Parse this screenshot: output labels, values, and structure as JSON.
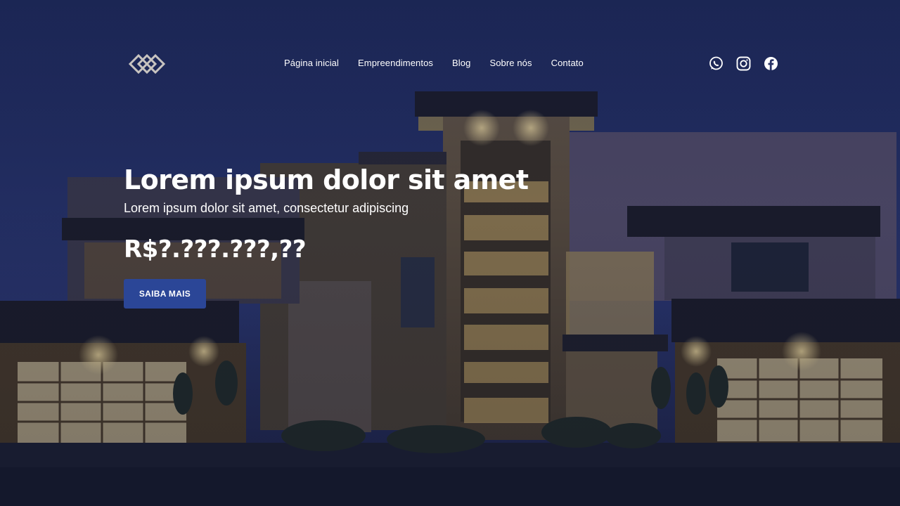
{
  "nav": {
    "items": [
      {
        "label": "Página inicial"
      },
      {
        "label": "Empreendimentos"
      },
      {
        "label": "Blog"
      },
      {
        "label": "Sobre nós"
      },
      {
        "label": "Contato"
      }
    ],
    "social": [
      "whatsapp-icon",
      "instagram-icon",
      "facebook-icon"
    ]
  },
  "hero": {
    "title": "Lorem ipsum dolor sit amet",
    "subtitle": "Lorem ipsum dolor sit amet, consectetur adipiscing",
    "price": "R$?.???.???,??",
    "cta_label": "SAIBA MAIS"
  },
  "colors": {
    "overlay": "#1c2450",
    "button": "#2b4697",
    "text": "#ffffff"
  }
}
